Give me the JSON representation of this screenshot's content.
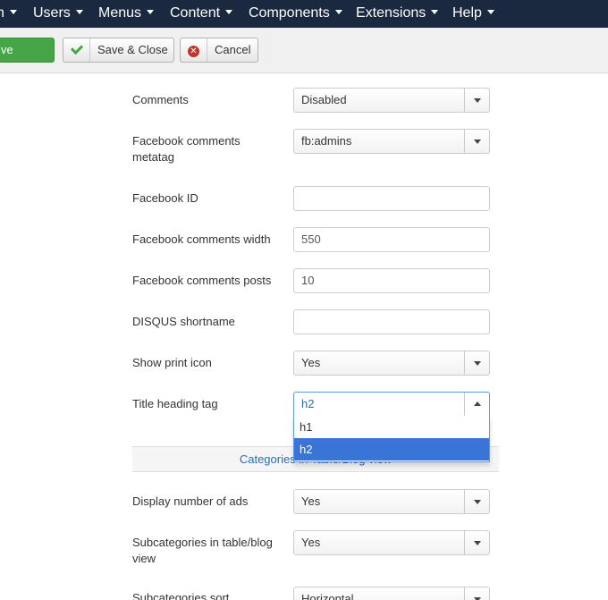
{
  "nav": {
    "items": [
      {
        "label": "n"
      },
      {
        "label": "Users"
      },
      {
        "label": "Menus"
      },
      {
        "label": "Content"
      },
      {
        "label": "Components"
      },
      {
        "label": "Extensions"
      },
      {
        "label": "Help"
      }
    ]
  },
  "toolbar": {
    "save_label": "ve",
    "save_close_label": "Save & Close",
    "cancel_label": "Cancel"
  },
  "form": {
    "comments": {
      "label": "Comments",
      "value": "Disabled"
    },
    "fb_metatag": {
      "label": "Facebook comments metatag",
      "value": "fb:admins"
    },
    "fb_id": {
      "label": "Facebook ID",
      "value": ""
    },
    "fb_width": {
      "label": "Facebook comments width",
      "value": "550"
    },
    "fb_posts": {
      "label": "Facebook comments posts",
      "value": "10"
    },
    "disqus": {
      "label": "DISQUS shortname",
      "value": ""
    },
    "print_icon": {
      "label": "Show print icon",
      "value": "Yes"
    },
    "title_tag": {
      "label": "Title heading tag",
      "value": "h2",
      "options": [
        "h1",
        "h2"
      ]
    },
    "section_title": "Categories in Table/Blog view",
    "num_ads": {
      "label": "Display number of ads",
      "value": "Yes"
    },
    "subcats": {
      "label": "Subcategories in table/blog view",
      "value": "Yes"
    },
    "subcats_sort": {
      "label": "Subcategories sort",
      "value": "Horizontal"
    }
  },
  "colors": {
    "navbar": "#1a2940",
    "save_green": "#46a546",
    "highlight": "#3875d7",
    "link_blue": "#2a6db3"
  }
}
